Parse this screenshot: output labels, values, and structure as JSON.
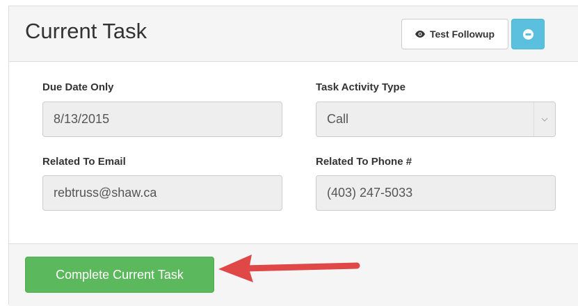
{
  "panel": {
    "title": "Current Task",
    "test_followup_label": "Test Followup",
    "followup_icon": "eye-icon",
    "collapse_icon": "minus-circle-icon"
  },
  "fields": {
    "due_date": {
      "label": "Due Date Only",
      "value": "8/13/2015"
    },
    "activity_type": {
      "label": "Task Activity Type",
      "value": "Call"
    },
    "email": {
      "label": "Related To Email",
      "value": "rebtruss@shaw.ca"
    },
    "phone": {
      "label": "Related To Phone #",
      "value": "(403) 247-5033"
    }
  },
  "footer": {
    "complete_label": "Complete Current Task"
  },
  "colors": {
    "info": "#5bc0de",
    "success": "#5cb85c",
    "annotation_arrow": "#e04848"
  }
}
